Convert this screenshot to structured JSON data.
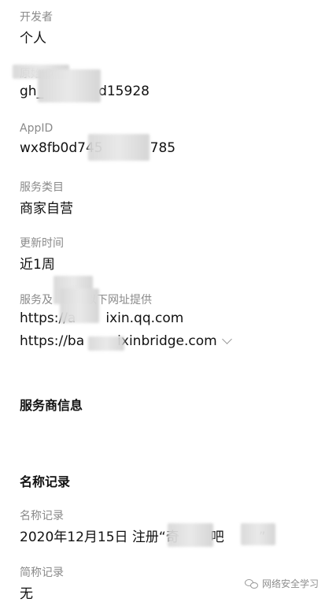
{
  "developer": {
    "label": "开发者",
    "value": "个人"
  },
  "original_id": {
    "label": "原始ID",
    "value_prefix": "gh_",
    "value_suffix": "d15928"
  },
  "appid": {
    "label": "AppID",
    "value_prefix": "wx8fb0d745",
    "value_suffix": "785"
  },
  "category": {
    "label": "服务类目",
    "value": "商家自营"
  },
  "updated": {
    "label": "更新时间",
    "value": "近1周"
  },
  "service_urls": {
    "label_prefix": "服务及",
    "label_suffix": "以下网址提供",
    "url1_prefix": "https://a",
    "url1_suffix": "ixin.qq.com",
    "url2_prefix": "https://ba",
    "url2_suffix": "ixinbridge.com",
    "expand_icon": "chevron-down-icon"
  },
  "provider_section": {
    "title": "服务商信息"
  },
  "name_record_section": {
    "title": "名称记录"
  },
  "name_record": {
    "label": "名称记录",
    "value_prefix": "2020年12月15日 注册“奇",
    "value_middle": "吧",
    "value_suffix": "”"
  },
  "short_name_record": {
    "label": "简称记录",
    "value": "无"
  },
  "watermark": {
    "icon": "wechat-icon",
    "text": "网络安全学习"
  }
}
